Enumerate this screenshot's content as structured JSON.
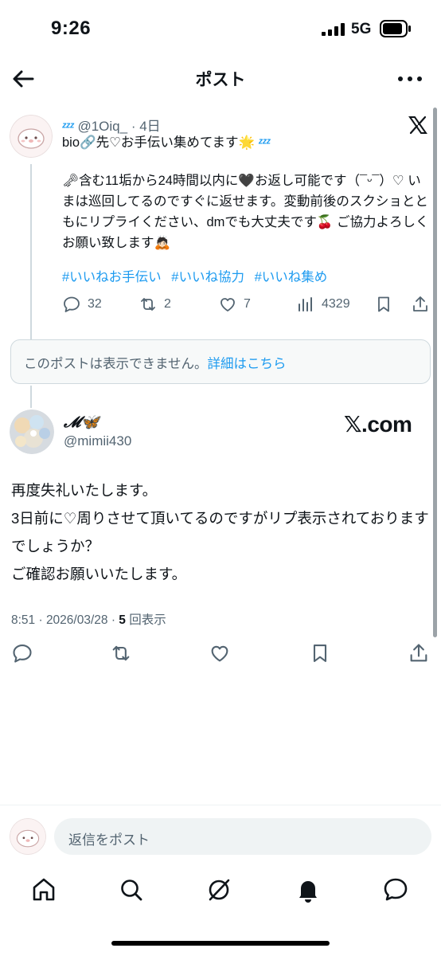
{
  "status_bar": {
    "time": "9:26",
    "network": "5G"
  },
  "nav": {
    "title": "ポスト"
  },
  "embedded_post": {
    "handle_meta": "@1Oiq_ · 4日",
    "bio_line": "bio🔗先♡お手伝い集めてます🌟",
    "body": "🗝含む11垢から24時間以内に🖤お返し可能です（¯ᵕ¯）♡ いまは巡回してるのですぐに返せます。変動前後のスクショとともにリプライください、dmでも大丈夫です🍒 ご協力よろしくお願い致します🙇🏻",
    "hashtags": [
      "#いいねお手伝い",
      "#いいね協力",
      "#いいね集め"
    ],
    "stats": {
      "replies": "32",
      "reposts": "2",
      "likes": "7",
      "views": "4329"
    }
  },
  "unavailable_notice": {
    "text": "このポストは表示できません。",
    "link": "詳細はこちら"
  },
  "post": {
    "author_name": "𝓜🦋",
    "author_handle": "@mimii430",
    "source_label": "𝕏.com",
    "lines": [
      "再度失礼いたします。",
      "3日前に♡周りさせて頂いてるのですがリプ表示されておりますでしょうか？",
      "ご確認お願いいたします。"
    ],
    "timestamp": "8:51 · 2026/03/28 · ",
    "views_count": "5",
    "views_label": " 回表示"
  },
  "reply": {
    "placeholder": "返信をポスト"
  },
  "colors": {
    "accent": "#1d9bf0",
    "secondary_text": "#536471",
    "text": "#0f1419"
  }
}
